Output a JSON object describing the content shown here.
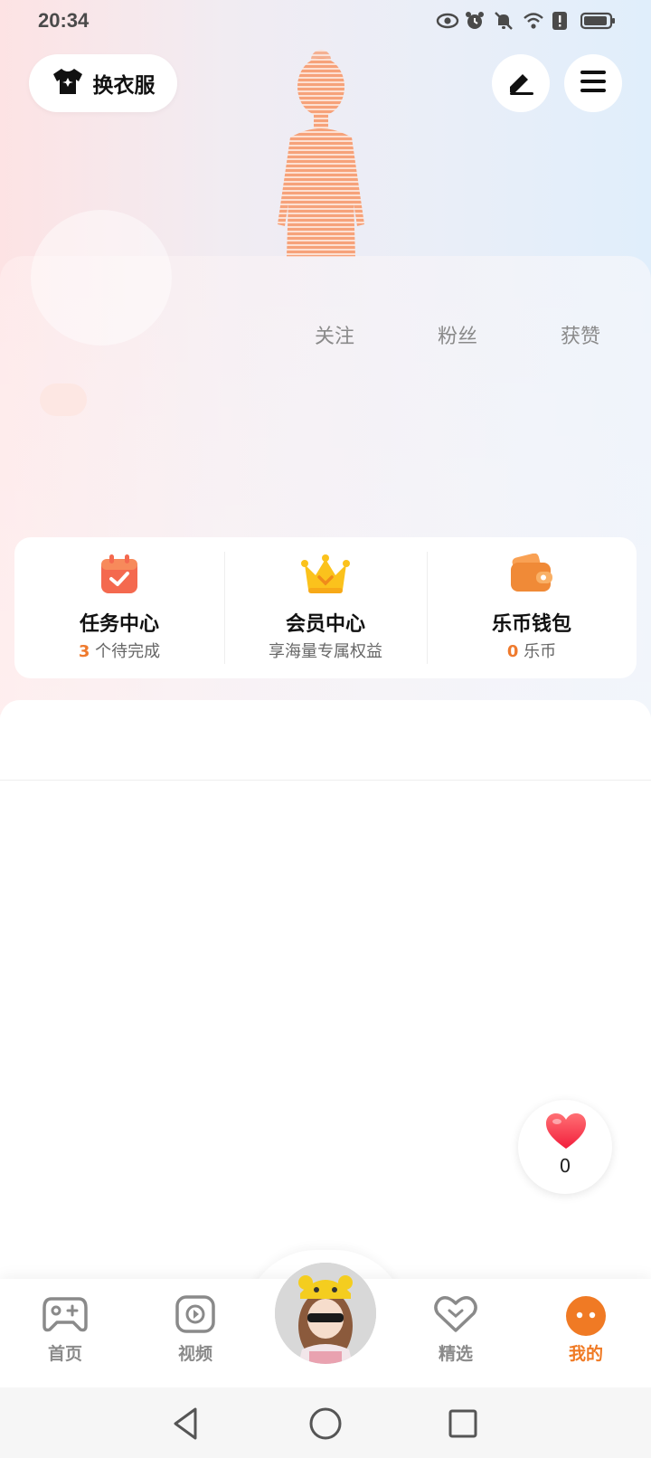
{
  "status_bar": {
    "time": "20:34"
  },
  "header": {
    "outfit_button_label": "换衣服",
    "edit_icon": "pen-icon",
    "menu_icon": "hamburger-icon"
  },
  "profile": {
    "stats": [
      {
        "label": "关注"
      },
      {
        "label": "粉丝"
      },
      {
        "label": "获赞"
      }
    ]
  },
  "quick_menu": [
    {
      "title": "任务中心",
      "sub_number": "3",
      "sub_text": " 个待完成",
      "icon": "calendar-check-icon"
    },
    {
      "title": "会员中心",
      "sub_text": "享海量专属权益",
      "icon": "crown-icon"
    },
    {
      "title": "乐币钱包",
      "sub_number": "0",
      "sub_text": " 乐币",
      "icon": "wallet-icon"
    }
  ],
  "like_button": {
    "count": "0"
  },
  "tabs": [
    {
      "label": "首页",
      "icon": "gamepad-icon"
    },
    {
      "label": "视频",
      "icon": "play-icon"
    },
    {
      "label": "精选",
      "icon": "heart-outline-icon"
    },
    {
      "label": "我的",
      "icon": "face-icon"
    }
  ],
  "colors": {
    "accent": "#f07a24",
    "inactive": "#8a8a8a"
  }
}
